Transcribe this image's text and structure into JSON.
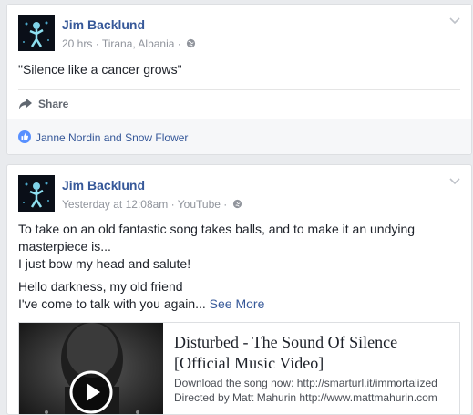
{
  "posts": [
    {
      "author": "Jim Backlund",
      "time": "20 hrs",
      "location": "Tirana, Albania",
      "privacy_icon": "globe-icon",
      "text": "\"Silence like a cancer grows\"",
      "share_label": "Share",
      "reactions": "Janne Nordin and Snow Flower"
    },
    {
      "author": "Jim Backlund",
      "time": "Yesterday at 12:08am",
      "source": "YouTube",
      "privacy_icon": "globe-icon",
      "lines": [
        "To take on an old fantastic song takes balls, and to make it an undying",
        "masterpiece is...",
        "I just bow my head and salute!"
      ],
      "lines2": [
        "Hello darkness, my old friend",
        "I've come to talk with you again..."
      ],
      "see_more": "See More",
      "link": {
        "title_line1": "Disturbed - The Sound Of Silence",
        "title_line2": "[Official Music Video]",
        "desc_line1": "Download the song now: http://smarturl.it/immortalized",
        "desc_line2": "Directed by Matt Mahurin http://www.mattmahurin.com"
      }
    }
  ],
  "colors": {
    "link_blue": "#365899",
    "meta_grey": "#90949c",
    "page_bg": "#e9ebee"
  }
}
